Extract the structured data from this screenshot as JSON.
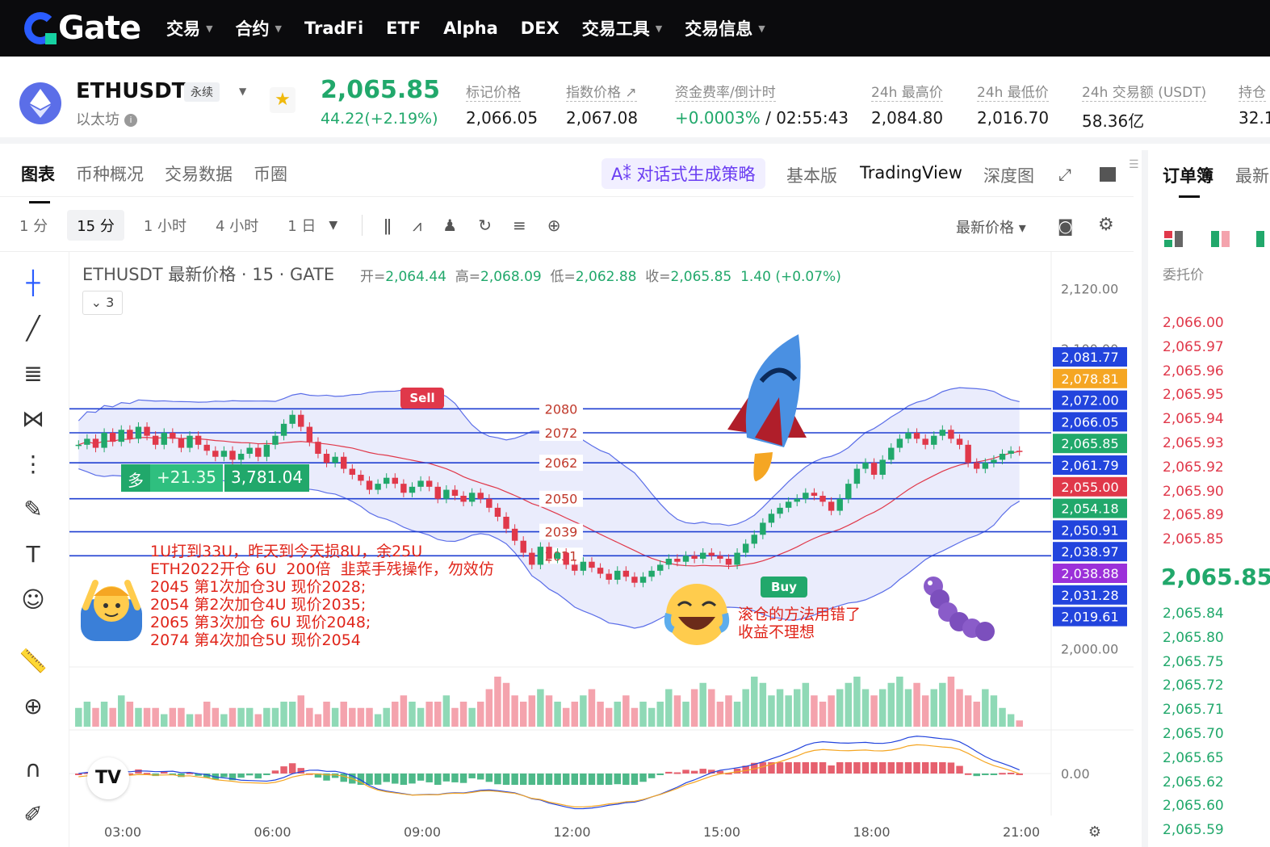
{
  "nav": {
    "logo": "Gate",
    "items": [
      {
        "label": "交易",
        "caret": true
      },
      {
        "label": "合约",
        "caret": true
      },
      {
        "label": "TradFi",
        "caret": false
      },
      {
        "label": "ETF",
        "caret": false
      },
      {
        "label": "Alpha",
        "caret": false
      },
      {
        "label": "DEX",
        "caret": false
      },
      {
        "label": "交易工具",
        "caret": true
      },
      {
        "label": "交易信息",
        "caret": true
      }
    ]
  },
  "ticker": {
    "symbol": "ETHUSDT",
    "tag": "永续",
    "name": "以太坊",
    "last_price": "2,065.85",
    "change": "44.22(+2.19%)",
    "stats": [
      {
        "label": "标记价格",
        "value": "2,066.05"
      },
      {
        "label": "指数价格 ↗",
        "value": "2,067.08"
      },
      {
        "label": "资金费率/倒计时",
        "value_green": "+0.0003%",
        "value": " / 02:55:43"
      },
      {
        "label": "24h 最高价",
        "value": "2,084.80"
      },
      {
        "label": "24h 最低价",
        "value": "2,016.70"
      },
      {
        "label": "24h 交易额 (USDT)",
        "value": "58.36亿"
      },
      {
        "label": "持仓",
        "value": "32.1"
      }
    ],
    "colors": {
      "up": "#21a86b",
      "down": "#e0384a"
    }
  },
  "chart_tabs": {
    "items": [
      "图表",
      "币种概况",
      "交易数据",
      "币圈"
    ],
    "ai_label": "A⁑ 对话式生成策略",
    "views": [
      "基本版",
      "TradingView",
      "深度图"
    ]
  },
  "toolbar": {
    "timeframes": [
      "1 分",
      "15 分",
      "1 小时",
      "4 小时",
      "1 日"
    ],
    "active_timeframe": "15 分",
    "price_type": "最新价格 ▾"
  },
  "chart_header": {
    "title": "ETHUSDT 最新价格 · 15 · GATE",
    "open_label": "开=",
    "open": "2,064.44",
    "high_label": "高=",
    "high": "2,068.09",
    "low_label": "低=",
    "low": "2,062.88",
    "close_label": "收=",
    "close": "2,065.85",
    "change": "1.40 (+0.07%)",
    "legend_count": "⌄ 3"
  },
  "position": {
    "side": "多",
    "pnl": "+21.35",
    "qty": "3,781.04"
  },
  "annotations": {
    "note_left": "1U打到33U，昨天到今天损8U，余25U\nETH2022开仓 6U  200倍  韭菜手残操作，勿效仿\n2045 第1次加仓3U 现价2028;\n2054 第2次加仓4U 现价2035;\n2065 第3次加仓 6U 现价2048;\n2074 第4次加仓5U 现价2054",
    "note_right": "滚仓的方法用错了\n收益不理想",
    "sell_label": "Sell",
    "buy_label": "Buy",
    "hlines": [
      "2080",
      "2072",
      "2062",
      "2050",
      "2039",
      "2031"
    ]
  },
  "chart_data": {
    "type": "candlestick",
    "interval": "15m",
    "ylim": [
      1995,
      2128
    ],
    "x_ticks": [
      "03:00",
      "06:00",
      "09:00",
      "12:00",
      "15:00",
      "18:00",
      "21:00"
    ],
    "y_ticks": [
      "2,120.00",
      "2,100.00",
      "2,000.00"
    ],
    "price_labels": [
      {
        "v": 2081.77,
        "text": "2,081.77",
        "color": "#2244dd"
      },
      {
        "v": 2078.81,
        "text": "2,078.81",
        "color": "#f5a623"
      },
      {
        "v": 2072.0,
        "text": "2,072.00",
        "color": "#2244dd"
      },
      {
        "v": 2066.05,
        "text": "2,066.05",
        "color": "#2244dd"
      },
      {
        "v": 2065.85,
        "text": "2,065.85",
        "color": "#21a86b"
      },
      {
        "v": 2061.79,
        "text": "2,061.79",
        "color": "#2244dd"
      },
      {
        "v": 2055.0,
        "text": "2,055.00",
        "color": "#e0384a"
      },
      {
        "v": 2054.18,
        "text": "2,054.18",
        "color": "#21a86b"
      },
      {
        "v": 2050.91,
        "text": "2,050.91",
        "color": "#2244dd"
      },
      {
        "v": 2038.97,
        "text": "2,038.97",
        "color": "#2244dd"
      },
      {
        "v": 2038.88,
        "text": "2,038.88",
        "color": "#9b30d9"
      },
      {
        "v": 2031.28,
        "text": "2,031.28",
        "color": "#2244dd"
      },
      {
        "v": 2019.61,
        "text": "2,019.61",
        "color": "#2244dd"
      }
    ],
    "closes": [
      2068,
      2070,
      2067,
      2072,
      2069,
      2073,
      2070,
      2074,
      2071,
      2068,
      2072,
      2070,
      2067,
      2071,
      2068,
      2066,
      2064,
      2066,
      2063,
      2065,
      2067,
      2064,
      2068,
      2071,
      2075,
      2078,
      2074,
      2069,
      2065,
      2062,
      2064,
      2060,
      2058,
      2056,
      2053,
      2055,
      2057,
      2055,
      2052,
      2054,
      2056,
      2054,
      2050,
      2053,
      2051,
      2049,
      2052,
      2050,
      2047,
      2044,
      2040,
      2036,
      2032,
      2028,
      2034,
      2030,
      2032,
      2028,
      2026,
      2029,
      2027,
      2025,
      2023,
      2026,
      2024,
      2022,
      2024,
      2026,
      2028,
      2030,
      2029,
      2031,
      2030,
      2032,
      2031,
      2030,
      2028,
      2032,
      2035,
      2038,
      2042,
      2045,
      2047,
      2049,
      2050,
      2052,
      2051,
      2049,
      2046,
      2050,
      2055,
      2060,
      2062,
      2058,
      2063,
      2067,
      2070,
      2072,
      2070,
      2068,
      2071,
      2073,
      2070,
      2068,
      2062,
      2060,
      2062,
      2063,
      2065,
      2066,
      2065.85
    ],
    "volumes": [
      3,
      4,
      3,
      4,
      3,
      5,
      4,
      3,
      3,
      3,
      2,
      3,
      3,
      2,
      2,
      4,
      3,
      2,
      3,
      3,
      3,
      2,
      3,
      3,
      4,
      4,
      5,
      3,
      2,
      4,
      3,
      4,
      3,
      3,
      3,
      2,
      3,
      4,
      5,
      4,
      3,
      4,
      4,
      5,
      3,
      4,
      3,
      4,
      6,
      8,
      7,
      5,
      4,
      5,
      6,
      5,
      4,
      3,
      4,
      5,
      6,
      4,
      3,
      4,
      5,
      3,
      4,
      3,
      4,
      6,
      5,
      4,
      6,
      7,
      6,
      4,
      5,
      4,
      6,
      8,
      7,
      5,
      6,
      5,
      6,
      7,
      5,
      4,
      5,
      6,
      7,
      8,
      6,
      5,
      6,
      7,
      8,
      6,
      7,
      5,
      6,
      7,
      8,
      6,
      5,
      4,
      6,
      5,
      3,
      2,
      1
    ],
    "macd": {
      "zero_label": "0.00"
    }
  },
  "orderbook": {
    "tab": "订单簿",
    "tab2": "最新",
    "col_label": "委托价",
    "asks": [
      "2,066.00",
      "2,065.97",
      "2,065.96",
      "2,065.95",
      "2,065.94",
      "2,065.93",
      "2,065.92",
      "2,065.90",
      "2,065.89",
      "2,065.85"
    ],
    "mid": "2,065.85",
    "bids": [
      "2,065.84",
      "2,065.80",
      "2,065.75",
      "2,065.72",
      "2,065.71",
      "2,065.70",
      "2,065.65",
      "2,065.62",
      "2,065.60",
      "2,065.59"
    ]
  }
}
